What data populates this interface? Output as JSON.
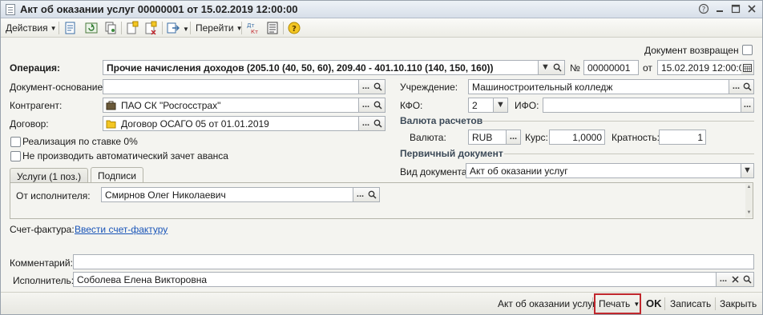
{
  "window": {
    "title": "Акт об оказании услуг 00000001 от 15.02.2019 12:00:00"
  },
  "toolbar": {
    "actions_label": "Действия",
    "goto_label": "Перейти"
  },
  "header": {
    "doc_returned_label": "Документ возвращен",
    "operation_label": "Операция:",
    "operation_value": "Прочие начисления доходов (205.10 (40, 50, 60), 209.40 - 401.10.110 (140, 150, 160))",
    "number_label": "№",
    "number_value": "00000001",
    "date_label": "от",
    "date_value": "15.02.2019 12:00:00"
  },
  "left": {
    "basis_label": "Документ-основание:",
    "basis_value": "",
    "counterparty_label": "Контрагент:",
    "counterparty_value": "ПАО СК \"Росгосстрах\"",
    "contract_label": "Договор:",
    "contract_value": "Договор ОСАГО 05 от 01.01.2019",
    "vat0_label": "Реализация по ставке 0%",
    "no_advance_label": "Не производить автоматический зачет аванса"
  },
  "right": {
    "institution_label": "Учреждение:",
    "institution_value": "Машиностроительный колледж",
    "kfo_label": "КФО:",
    "kfo_value": "2",
    "ifo_label": "ИФО:",
    "ifo_value": "",
    "currency_section": "Валюта расчетов",
    "currency_label": "Валюта:",
    "currency_value": "RUB",
    "rate_label": "Курс:",
    "rate_value": "1,0000",
    "multiplicity_label": "Кратность:",
    "multiplicity_value": "1",
    "primary_section": "Первичный документ",
    "doc_type_label": "Вид документа:",
    "doc_type_value": "Акт об оказании услуг"
  },
  "tabs": [
    {
      "label": "Услуги (1 поз.)"
    },
    {
      "label": "Подписи"
    }
  ],
  "signatures": {
    "performer_label": "От исполнителя:",
    "performer_value": "Смирнов Олег Николаевич"
  },
  "invoice": {
    "label": "Счет-фактура:",
    "link": "Ввести счет-фактуру"
  },
  "bottom": {
    "comment_label": "Комментарий:",
    "comment_value": "",
    "executor_label": "Исполнитель:",
    "executor_value": "Соболева Елена Викторовна"
  },
  "footer": {
    "act_label": "Акт об оказании услуг",
    "print_label": "Печать",
    "ok_label": "OK",
    "save_label": "Записать",
    "close_label": "Закрыть"
  },
  "colors": {
    "highlight": "#c0272d",
    "link": "#1a55b8"
  }
}
